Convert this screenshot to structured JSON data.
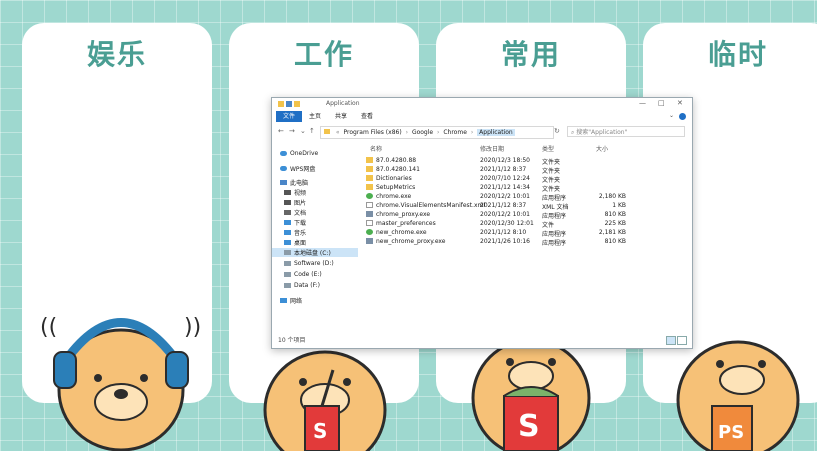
{
  "panels": [
    {
      "title": "娱乐"
    },
    {
      "title": "工作"
    },
    {
      "title": "常用"
    },
    {
      "title": "临时"
    }
  ],
  "explorer": {
    "title": "Application",
    "window_controls": {
      "minimize": "—",
      "maximize": "□",
      "close": "✕"
    },
    "ribbon_tabs": [
      "文件",
      "主页",
      "共享",
      "查看"
    ],
    "address": {
      "path": [
        "Program Files (x86)",
        "Google",
        "Chrome",
        "Application"
      ],
      "prefix": "«"
    },
    "search_placeholder": "搜索\"Application\"",
    "nav": [
      {
        "label": "OneDrive",
        "icon": "cloud-icon"
      },
      {
        "label": "WPS网盘",
        "icon": "cloud-icon"
      },
      {
        "label": "此电脑",
        "icon": "computer-icon"
      },
      {
        "label": "视频",
        "icon": "video-icon"
      },
      {
        "label": "图片",
        "icon": "picture-icon"
      },
      {
        "label": "文档",
        "icon": "document-icon"
      },
      {
        "label": "下载",
        "icon": "download-icon"
      },
      {
        "label": "音乐",
        "icon": "music-icon"
      },
      {
        "label": "桌面",
        "icon": "desktop-icon"
      },
      {
        "label": "本地磁盘 (C:)",
        "icon": "drive-icon",
        "selected": true
      },
      {
        "label": "Software (D:)",
        "icon": "drive-icon"
      },
      {
        "label": "Code (E:)",
        "icon": "drive-icon"
      },
      {
        "label": "Data (F:)",
        "icon": "drive-icon"
      },
      {
        "label": "网络",
        "icon": "network-icon"
      }
    ],
    "columns": [
      "名称",
      "修改日期",
      "类型",
      "大小"
    ],
    "files": [
      {
        "name": "87.0.4280.88",
        "date": "2020/12/3 18:50",
        "type": "文件夹",
        "size": "",
        "icon": "folder-icon"
      },
      {
        "name": "87.0.4280.141",
        "date": "2021/1/12 8:37",
        "type": "文件夹",
        "size": "",
        "icon": "folder-icon"
      },
      {
        "name": "Dictionaries",
        "date": "2020/7/10 12:24",
        "type": "文件夹",
        "size": "",
        "icon": "folder-icon"
      },
      {
        "name": "SetupMetrics",
        "date": "2021/1/12 14:34",
        "type": "文件夹",
        "size": "",
        "icon": "folder-icon"
      },
      {
        "name": "chrome.exe",
        "date": "2020/12/2 10:01",
        "type": "应用程序",
        "size": "2,180 KB",
        "icon": "chrome-icon"
      },
      {
        "name": "chrome.VisualElementsManifest.xml",
        "date": "2021/1/12 8:37",
        "type": "XML 文档",
        "size": "1 KB",
        "icon": "xml-icon"
      },
      {
        "name": "chrome_proxy.exe",
        "date": "2020/12/2 10:01",
        "type": "应用程序",
        "size": "810 KB",
        "icon": "exe-icon"
      },
      {
        "name": "master_preferences",
        "date": "2020/12/30 12:01",
        "type": "文件",
        "size": "225 KB",
        "icon": "file-icon"
      },
      {
        "name": "new_chrome.exe",
        "date": "2021/1/12 8:10",
        "type": "应用程序",
        "size": "2,181 KB",
        "icon": "chrome-icon"
      },
      {
        "name": "new_chrome_proxy.exe",
        "date": "2021/1/26 10:16",
        "type": "应用程序",
        "size": "810 KB",
        "icon": "exe-icon"
      }
    ],
    "status": "10 个项目"
  }
}
